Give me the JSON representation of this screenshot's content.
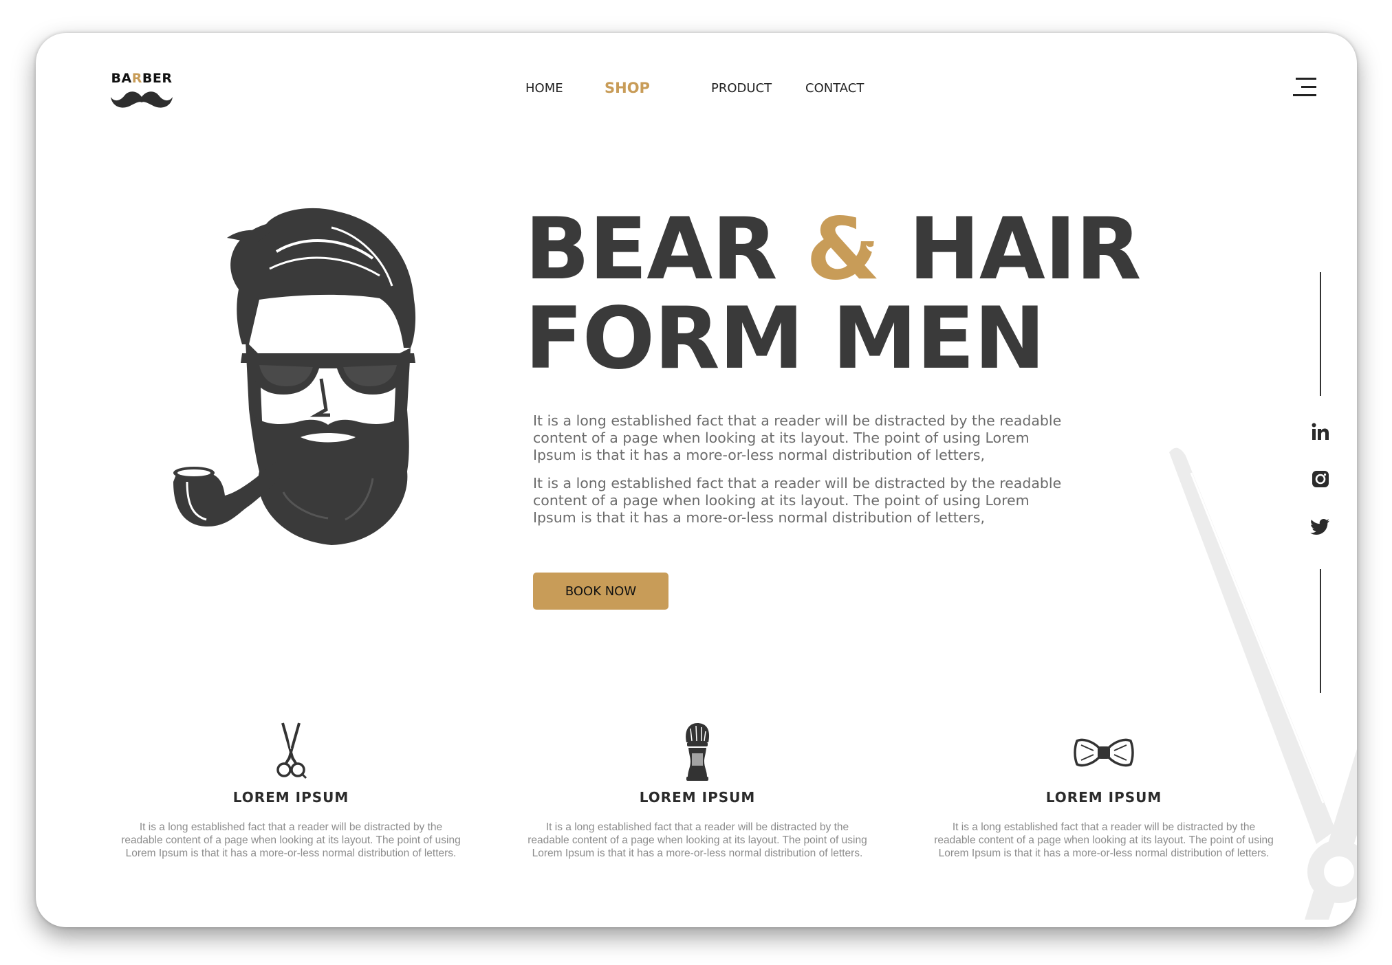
{
  "brand": {
    "logo_prefix": "BA",
    "logo_accent": "R",
    "logo_suffix": "BER",
    "accent_color": "#c89c58"
  },
  "nav": {
    "items": [
      "HOME",
      "SHOP",
      "PRODUCT",
      "CONTACT"
    ],
    "active": "SHOP"
  },
  "hero": {
    "title_part1": "BEAR ",
    "title_amp": "&",
    "title_part2": " HAIR",
    "title_line2": "FORM MEN",
    "paragraphs": [
      "It is a long established fact that a reader will be distracted by the readable content of a page when looking at its layout. The point of using Lorem Ipsum is that it has a more-or-less normal distribution of letters,",
      "It is a long established fact that a reader will be distracted by the readable content of a page when looking at its layout. The point of using Lorem Ipsum is that it has a more-or-less normal distribution of letters,"
    ],
    "cta_label": "BOOK NOW"
  },
  "social": [
    "linkedin-icon",
    "instagram-icon",
    "twitter-icon"
  ],
  "features": [
    {
      "icon": "scissors-icon",
      "title": "LOREM IPSUM",
      "text": "It is a long established fact that a reader will be distracted by the readable content of a page when looking at its layout. The point of using Lorem Ipsum is that it has a more-or-less normal distribution of letters."
    },
    {
      "icon": "shaving-brush-icon",
      "title": "LOREM IPSUM",
      "text": "It is a long established fact that a reader will be distracted by the readable content of a page when looking at its layout. The point of using Lorem Ipsum is that it has a more-or-less normal distribution of letters."
    },
    {
      "icon": "bow-tie-icon",
      "title": "LOREM IPSUM",
      "text": "It is a long established fact that a reader will be distracted by the readable content of a page when looking at its layout. The point of using Lorem Ipsum is that it has a more-or-less normal distribution of letters."
    }
  ]
}
